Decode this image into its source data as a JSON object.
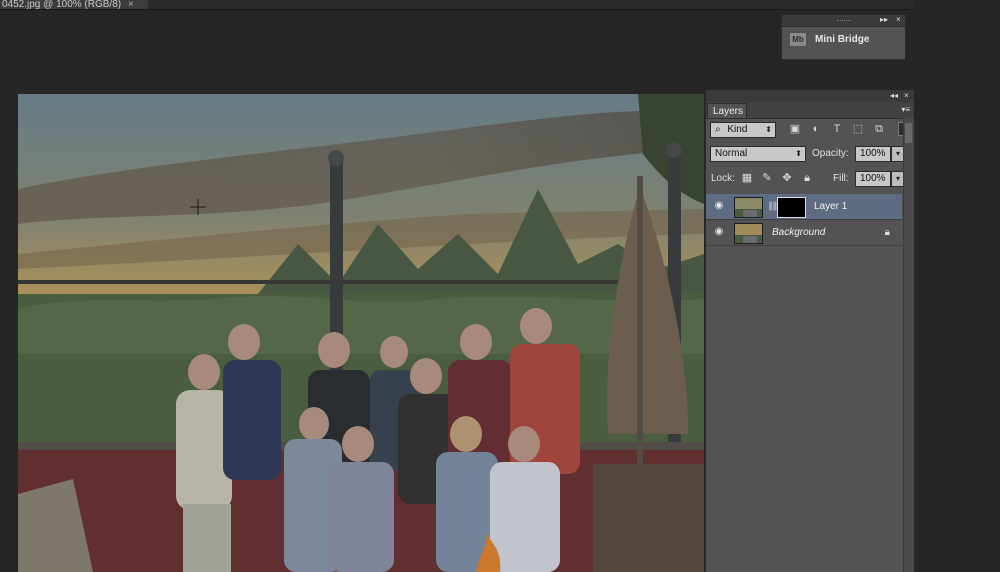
{
  "document": {
    "tab_title": "0452.jpg @ 100% (RGB/8)",
    "close_glyph": "×"
  },
  "mini_bridge": {
    "icon_text": "Mb",
    "label": "Mini Bridge",
    "collapse_glyph": "▸▸",
    "close_glyph": "×"
  },
  "layers_panel": {
    "collapse_glyph": "◂◂",
    "close_glyph": "×",
    "tab_label": "Layers",
    "menu_glyph": "▾≡",
    "filter": {
      "search_glyph": "⌕",
      "kind_label": "Kind",
      "icons": [
        "image-filter-icon",
        "adjustment-filter-icon",
        "type-filter-icon",
        "shape-filter-icon",
        "smart-object-filter-icon"
      ]
    },
    "blend_mode": "Normal",
    "opacity_label": "Opacity:",
    "opacity_value": "100%",
    "lock_label": "Lock:",
    "fill_label": "Fill:",
    "fill_value": "100%",
    "layers": [
      {
        "name": "Layer 1",
        "active": true,
        "has_mask": true
      },
      {
        "name": "Background",
        "active": false,
        "locked": true
      }
    ]
  },
  "colors": {
    "app_bg": "#262626",
    "panel_bg": "#535353",
    "selection": "#5d6c82"
  }
}
